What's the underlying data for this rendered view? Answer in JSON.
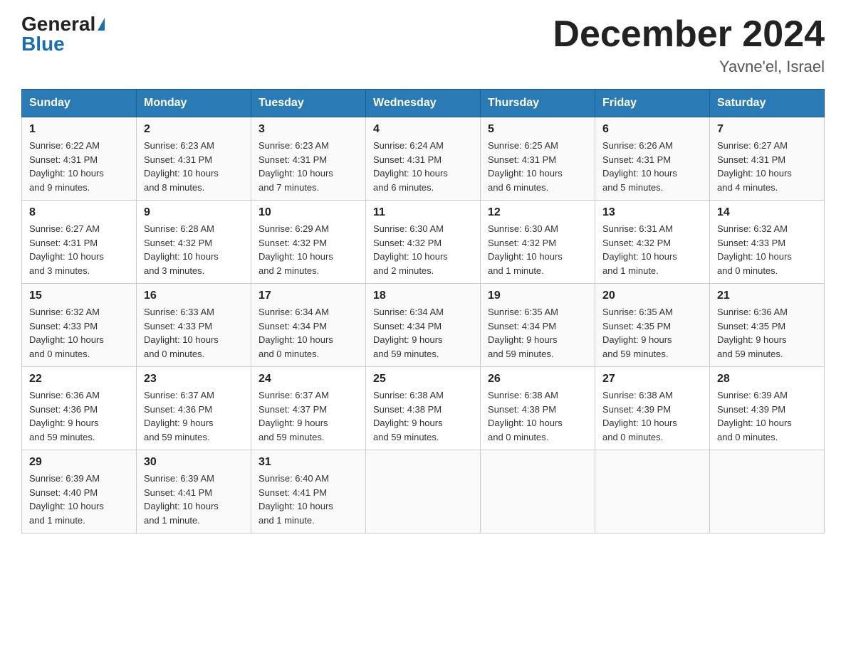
{
  "header": {
    "logo_general": "General",
    "logo_blue": "Blue",
    "title": "December 2024",
    "subtitle": "Yavne'el, Israel"
  },
  "weekdays": [
    "Sunday",
    "Monday",
    "Tuesday",
    "Wednesday",
    "Thursday",
    "Friday",
    "Saturday"
  ],
  "rows": [
    [
      {
        "day": "1",
        "info": "Sunrise: 6:22 AM\nSunset: 4:31 PM\nDaylight: 10 hours\nand 9 minutes."
      },
      {
        "day": "2",
        "info": "Sunrise: 6:23 AM\nSunset: 4:31 PM\nDaylight: 10 hours\nand 8 minutes."
      },
      {
        "day": "3",
        "info": "Sunrise: 6:23 AM\nSunset: 4:31 PM\nDaylight: 10 hours\nand 7 minutes."
      },
      {
        "day": "4",
        "info": "Sunrise: 6:24 AM\nSunset: 4:31 PM\nDaylight: 10 hours\nand 6 minutes."
      },
      {
        "day": "5",
        "info": "Sunrise: 6:25 AM\nSunset: 4:31 PM\nDaylight: 10 hours\nand 6 minutes."
      },
      {
        "day": "6",
        "info": "Sunrise: 6:26 AM\nSunset: 4:31 PM\nDaylight: 10 hours\nand 5 minutes."
      },
      {
        "day": "7",
        "info": "Sunrise: 6:27 AM\nSunset: 4:31 PM\nDaylight: 10 hours\nand 4 minutes."
      }
    ],
    [
      {
        "day": "8",
        "info": "Sunrise: 6:27 AM\nSunset: 4:31 PM\nDaylight: 10 hours\nand 3 minutes."
      },
      {
        "day": "9",
        "info": "Sunrise: 6:28 AM\nSunset: 4:32 PM\nDaylight: 10 hours\nand 3 minutes."
      },
      {
        "day": "10",
        "info": "Sunrise: 6:29 AM\nSunset: 4:32 PM\nDaylight: 10 hours\nand 2 minutes."
      },
      {
        "day": "11",
        "info": "Sunrise: 6:30 AM\nSunset: 4:32 PM\nDaylight: 10 hours\nand 2 minutes."
      },
      {
        "day": "12",
        "info": "Sunrise: 6:30 AM\nSunset: 4:32 PM\nDaylight: 10 hours\nand 1 minute."
      },
      {
        "day": "13",
        "info": "Sunrise: 6:31 AM\nSunset: 4:32 PM\nDaylight: 10 hours\nand 1 minute."
      },
      {
        "day": "14",
        "info": "Sunrise: 6:32 AM\nSunset: 4:33 PM\nDaylight: 10 hours\nand 0 minutes."
      }
    ],
    [
      {
        "day": "15",
        "info": "Sunrise: 6:32 AM\nSunset: 4:33 PM\nDaylight: 10 hours\nand 0 minutes."
      },
      {
        "day": "16",
        "info": "Sunrise: 6:33 AM\nSunset: 4:33 PM\nDaylight: 10 hours\nand 0 minutes."
      },
      {
        "day": "17",
        "info": "Sunrise: 6:34 AM\nSunset: 4:34 PM\nDaylight: 10 hours\nand 0 minutes."
      },
      {
        "day": "18",
        "info": "Sunrise: 6:34 AM\nSunset: 4:34 PM\nDaylight: 9 hours\nand 59 minutes."
      },
      {
        "day": "19",
        "info": "Sunrise: 6:35 AM\nSunset: 4:34 PM\nDaylight: 9 hours\nand 59 minutes."
      },
      {
        "day": "20",
        "info": "Sunrise: 6:35 AM\nSunset: 4:35 PM\nDaylight: 9 hours\nand 59 minutes."
      },
      {
        "day": "21",
        "info": "Sunrise: 6:36 AM\nSunset: 4:35 PM\nDaylight: 9 hours\nand 59 minutes."
      }
    ],
    [
      {
        "day": "22",
        "info": "Sunrise: 6:36 AM\nSunset: 4:36 PM\nDaylight: 9 hours\nand 59 minutes."
      },
      {
        "day": "23",
        "info": "Sunrise: 6:37 AM\nSunset: 4:36 PM\nDaylight: 9 hours\nand 59 minutes."
      },
      {
        "day": "24",
        "info": "Sunrise: 6:37 AM\nSunset: 4:37 PM\nDaylight: 9 hours\nand 59 minutes."
      },
      {
        "day": "25",
        "info": "Sunrise: 6:38 AM\nSunset: 4:38 PM\nDaylight: 9 hours\nand 59 minutes."
      },
      {
        "day": "26",
        "info": "Sunrise: 6:38 AM\nSunset: 4:38 PM\nDaylight: 10 hours\nand 0 minutes."
      },
      {
        "day": "27",
        "info": "Sunrise: 6:38 AM\nSunset: 4:39 PM\nDaylight: 10 hours\nand 0 minutes."
      },
      {
        "day": "28",
        "info": "Sunrise: 6:39 AM\nSunset: 4:39 PM\nDaylight: 10 hours\nand 0 minutes."
      }
    ],
    [
      {
        "day": "29",
        "info": "Sunrise: 6:39 AM\nSunset: 4:40 PM\nDaylight: 10 hours\nand 1 minute."
      },
      {
        "day": "30",
        "info": "Sunrise: 6:39 AM\nSunset: 4:41 PM\nDaylight: 10 hours\nand 1 minute."
      },
      {
        "day": "31",
        "info": "Sunrise: 6:40 AM\nSunset: 4:41 PM\nDaylight: 10 hours\nand 1 minute."
      },
      {
        "day": "",
        "info": ""
      },
      {
        "day": "",
        "info": ""
      },
      {
        "day": "",
        "info": ""
      },
      {
        "day": "",
        "info": ""
      }
    ]
  ]
}
